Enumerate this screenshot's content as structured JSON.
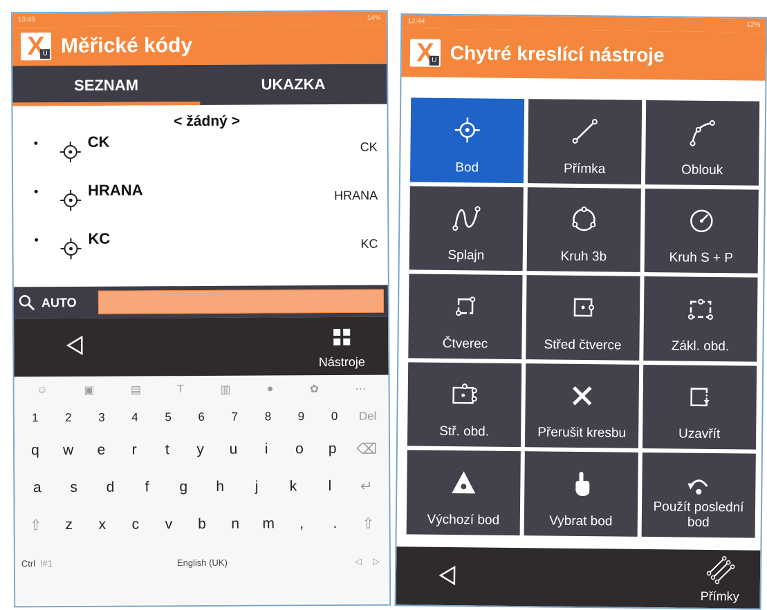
{
  "left": {
    "status_time": "13:49",
    "status_right": "14%",
    "title": "Měřické kódy",
    "tabs": [
      "SEZNAM",
      "UKAZKA"
    ],
    "none_item": "< žádný >",
    "items": [
      {
        "code": "CK",
        "right": "CK"
      },
      {
        "code": "HRANA",
        "right": "HRANA"
      },
      {
        "code": "KC",
        "right": "KC"
      }
    ],
    "search_label": "AUTO",
    "search_value": "",
    "tools_label": "Nástroje",
    "keyboard": {
      "numbers": [
        "1",
        "2",
        "3",
        "4",
        "5",
        "6",
        "7",
        "8",
        "9",
        "0",
        "Del"
      ],
      "row1": [
        "q",
        "w",
        "e",
        "r",
        "t",
        "y",
        "u",
        "i",
        "o",
        "p"
      ],
      "row2": [
        "a",
        "s",
        "d",
        "f",
        "g",
        "h",
        "j",
        "k",
        "l"
      ],
      "row3": [
        "z",
        "x",
        "c",
        "v",
        "b",
        "n",
        "m",
        ",",
        "."
      ],
      "ctrl": "Ctrl",
      "symbols": "!#1",
      "language": "English (UK)"
    }
  },
  "right": {
    "status_time": "12:44",
    "status_right": "12%",
    "title": "Chytré kreslící nástroje",
    "tools": [
      {
        "label": "Bod",
        "icon": "point-target-icon",
        "active": true
      },
      {
        "label": "Přímka",
        "icon": "line-icon"
      },
      {
        "label": "Oblouk",
        "icon": "arc-icon"
      },
      {
        "label": "Splajn",
        "icon": "spline-icon"
      },
      {
        "label": "Kruh 3b",
        "icon": "circle-3-points-icon"
      },
      {
        "label": "Kruh S + P",
        "icon": "circle-center-radius-icon"
      },
      {
        "label": "Čtverec",
        "icon": "square-icon"
      },
      {
        "label": "Střed čtverce",
        "icon": "square-center-icon"
      },
      {
        "label": "Zákl. obd.",
        "icon": "rectangle-base-icon"
      },
      {
        "label": "Stř. obd.",
        "icon": "rectangle-center-icon"
      },
      {
        "label": "Přerušit kresbu",
        "icon": "close-x-icon"
      },
      {
        "label": "Uzavřít",
        "icon": "close-shape-icon"
      },
      {
        "label": "Výchozí bod",
        "icon": "start-point-icon"
      },
      {
        "label": "Vybrat bod",
        "icon": "select-point-hand-icon"
      },
      {
        "label": "Použít poslední bod",
        "icon": "undo-last-point-icon"
      }
    ],
    "lines_label": "Přímky"
  },
  "colors": {
    "orange": "#f4873d",
    "dark": "#43414c",
    "active_blue": "#1f63c9",
    "nav": "#2f2a2b"
  }
}
